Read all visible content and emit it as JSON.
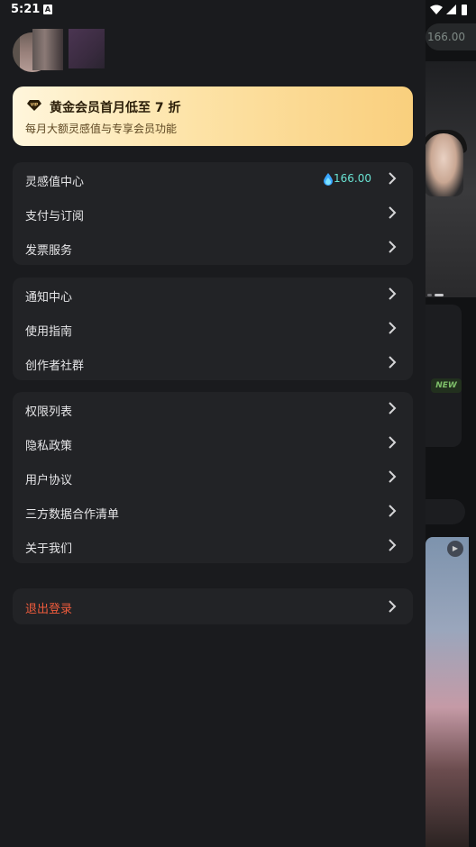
{
  "status_bar": {
    "time": "5:21",
    "notif_glyph": "A"
  },
  "profile": {
    "avatar": "avatar-image"
  },
  "vip_banner": {
    "title": "黄金会员首月低至 7 折",
    "subtitle": "每月大额灵感值与专享会员功能",
    "icon": "vip-diamond-icon"
  },
  "menu": {
    "group1": [
      {
        "label": "灵感值中心",
        "value": "166.00",
        "icon": "drop-icon"
      },
      {
        "label": "支付与订阅"
      },
      {
        "label": "发票服务"
      }
    ],
    "group2": [
      {
        "label": "通知中心"
      },
      {
        "label": "使用指南"
      },
      {
        "label": "创作者社群"
      }
    ],
    "group3": [
      {
        "label": "权限列表"
      },
      {
        "label": "隐私政策"
      },
      {
        "label": "用户协议"
      },
      {
        "label": "三方数据合作清单"
      },
      {
        "label": "关于我们"
      }
    ],
    "logout": {
      "label": "退出登录"
    }
  },
  "background_app": {
    "balance": "166.00",
    "badge": "NEW"
  },
  "colors": {
    "accent_value": "#69e2d2",
    "logout": "#ee5b3c",
    "vip_gold": "#f9cf7d"
  }
}
